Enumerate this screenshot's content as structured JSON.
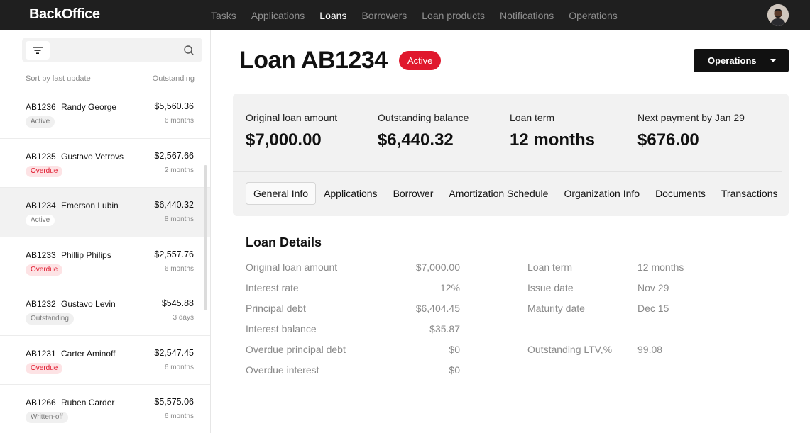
{
  "app": {
    "brand": "BackOffice"
  },
  "nav": {
    "items": [
      {
        "label": "Tasks",
        "active": false
      },
      {
        "label": "Applications",
        "active": false
      },
      {
        "label": "Loans",
        "active": true
      },
      {
        "label": "Borrowers",
        "active": false
      },
      {
        "label": "Loan products",
        "active": false
      },
      {
        "label": "Notifications",
        "active": false
      },
      {
        "label": "Operations",
        "active": false
      }
    ]
  },
  "sidebar": {
    "sort_label": "Sort by last update",
    "outstanding_label": "Outstanding",
    "loans": [
      {
        "id": "AB1236",
        "name": "Randy George",
        "amount": "$5,560.36",
        "status": "Active",
        "period": "6 months",
        "selected": false
      },
      {
        "id": "AB1235",
        "name": "Gustavo Vetrovs",
        "amount": "$2,567.66",
        "status": "Overdue",
        "period": "2 months",
        "selected": false
      },
      {
        "id": "AB1234",
        "name": "Emerson Lubin",
        "amount": "$6,440.32",
        "status": "Active",
        "period": "8 months",
        "selected": true
      },
      {
        "id": "AB1233",
        "name": "Phillip Philips",
        "amount": "$2,557.76",
        "status": "Overdue",
        "period": "6 months",
        "selected": false
      },
      {
        "id": "AB1232",
        "name": "Gustavo Levin",
        "amount": "$545.88",
        "status": "Outstanding",
        "period": "3 days",
        "selected": false
      },
      {
        "id": "AB1231",
        "name": "Carter Aminoff",
        "amount": "$2,547.45",
        "status": "Overdue",
        "period": "6 months",
        "selected": false
      },
      {
        "id": "AB1266",
        "name": "Ruben Carder",
        "amount": "$5,575.06",
        "status": "Written-off",
        "period": "6 months",
        "selected": false
      }
    ]
  },
  "loan": {
    "title": "Loan AB1234",
    "status": "Active",
    "operations_label": "Operations"
  },
  "summary": {
    "metrics": [
      {
        "label": "Original loan amount",
        "value": "$7,000.00"
      },
      {
        "label": "Outstanding balance",
        "value": "$6,440.32"
      },
      {
        "label": "Loan term",
        "value": "12 months"
      },
      {
        "label": "Next payment by Jan 29",
        "value": "$676.00"
      }
    ],
    "tabs": [
      {
        "label": "General Info",
        "active": true
      },
      {
        "label": "Applications",
        "active": false
      },
      {
        "label": "Borrower",
        "active": false
      },
      {
        "label": "Amortization Schedule",
        "active": false
      },
      {
        "label": "Organization Info",
        "active": false
      },
      {
        "label": "Documents",
        "active": false
      },
      {
        "label": "Transactions",
        "active": false
      }
    ]
  },
  "details": {
    "title": "Loan Details",
    "left": [
      {
        "label": "Original loan amount",
        "value": "$7,000.00"
      },
      {
        "label": "Interest rate",
        "value": "12%"
      },
      {
        "label": "Principal debt",
        "value": "$6,404.45"
      },
      {
        "label": "Interest balance",
        "value": "$35.87"
      },
      {
        "label": "Overdue principal debt",
        "value": "$0"
      },
      {
        "label": "Overdue interest",
        "value": "$0"
      }
    ],
    "right": [
      {
        "label": "Loan term",
        "value": "12 months"
      },
      {
        "label": "Issue date",
        "value": "Nov 29"
      },
      {
        "label": "Maturity date",
        "value": "Dec 15"
      },
      {
        "label": "Outstanding LTV,%",
        "value": "99.08"
      }
    ]
  },
  "colors": {
    "accent_red": "#e0182d",
    "topbar": "#1f1f1f",
    "panel": "#f2f2f2"
  }
}
